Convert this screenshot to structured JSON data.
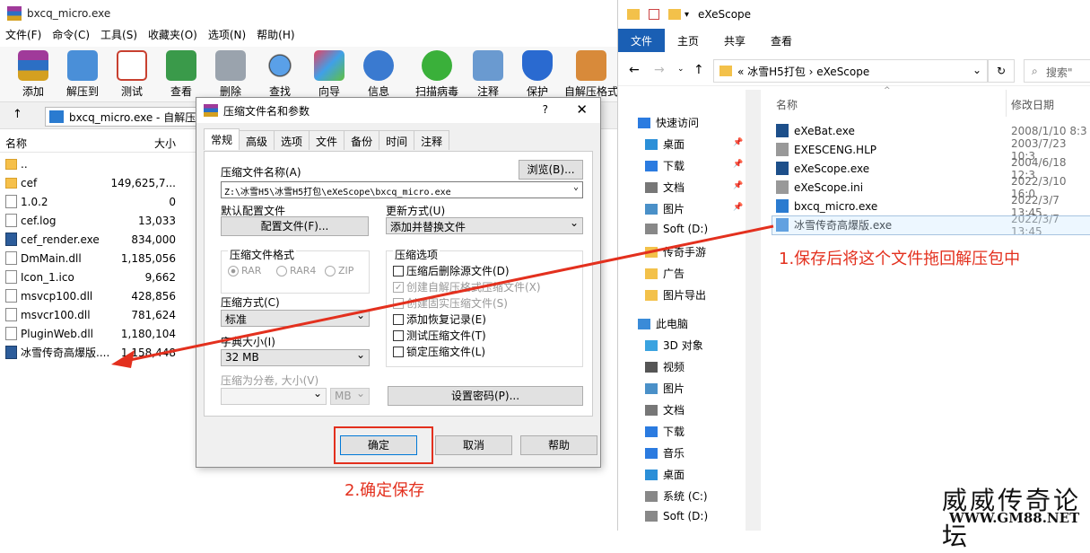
{
  "rar": {
    "title": "bxcq_micro.exe",
    "menu": [
      "文件(F)",
      "命令(C)",
      "工具(S)",
      "收藏夹(O)",
      "选项(N)",
      "帮助(H)"
    ],
    "toolbar": [
      "添加",
      "解压到",
      "测试",
      "查看",
      "删除",
      "查找",
      "向导",
      "信息",
      "扫描病毒",
      "注释",
      "保护",
      "自解压格式"
    ],
    "address": "bxcq_micro.exe - 自解压",
    "columns": {
      "name": "名称",
      "size": "大小"
    },
    "files": [
      {
        "name": "..",
        "size": "",
        "icon": "folder"
      },
      {
        "name": "cef",
        "size": "149,625,7...",
        "icon": "folder"
      },
      {
        "name": "1.0.2",
        "size": "0",
        "icon": "file"
      },
      {
        "name": "cef.log",
        "size": "13,033",
        "icon": "file"
      },
      {
        "name": "cef_render.exe",
        "size": "834,000",
        "icon": "exe"
      },
      {
        "name": "DmMain.dll",
        "size": "1,185,056",
        "icon": "file"
      },
      {
        "name": "Icon_1.ico",
        "size": "9,662",
        "icon": "file"
      },
      {
        "name": "msvcp100.dll",
        "size": "428,856",
        "icon": "file"
      },
      {
        "name": "msvcr100.dll",
        "size": "781,624",
        "icon": "file"
      },
      {
        "name": "PluginWeb.dll",
        "size": "1,180,104",
        "icon": "file"
      },
      {
        "name": "冰雪传奇高爆版....",
        "size": "1,158,448",
        "icon": "exe"
      }
    ]
  },
  "dialog": {
    "title": "压缩文件名和参数",
    "help": "?",
    "tabs": [
      "常规",
      "高级",
      "选项",
      "文件",
      "备份",
      "时间",
      "注释"
    ],
    "archive_name_label": "压缩文件名称(A)",
    "browse": "浏览(B)...",
    "archive_path": "Z:\\冰雪H5\\冰雪H5打包\\eXeScope\\bxcq_micro.exe",
    "default_config_label": "默认配置文件",
    "config_btn": "配置文件(F)...",
    "update_label": "更新方式(U)",
    "update_value": "添加并替换文件",
    "format_label": "压缩文件格式",
    "formats": [
      "RAR",
      "RAR4",
      "ZIP"
    ],
    "options_label": "压缩选项",
    "options": [
      {
        "text": "压缩后删除源文件(D)",
        "checked": false,
        "disabled": false
      },
      {
        "text": "创建自解压格式压缩文件(X)",
        "checked": true,
        "disabled": true
      },
      {
        "text": "创建固实压缩文件(S)",
        "checked": false,
        "disabled": true
      },
      {
        "text": "添加恢复记录(E)",
        "checked": false,
        "disabled": false
      },
      {
        "text": "测试压缩文件(T)",
        "checked": false,
        "disabled": false
      },
      {
        "text": "锁定压缩文件(L)",
        "checked": false,
        "disabled": false
      }
    ],
    "method_label": "压缩方式(C)",
    "method_value": "标准",
    "dict_label": "字典大小(I)",
    "dict_value": "32 MB",
    "split_label": "压缩为分卷, 大小(V)",
    "split_unit": "MB",
    "password_btn": "设置密码(P)...",
    "ok": "确定",
    "cancel": "取消",
    "helpbtn": "帮助"
  },
  "explorer": {
    "title": "eXeScope",
    "ribbon": [
      "文件",
      "主页",
      "共享",
      "查看"
    ],
    "crumbs": "«  冰雪H5打包  ›  eXeScope",
    "search": "搜索\"",
    "col_name": "名称",
    "col_date": "修改日期",
    "nav": [
      {
        "label": "快速访问",
        "color": "#2b7be0",
        "pin": false
      },
      {
        "label": "桌面",
        "color": "#2b8fd8",
        "pin": true
      },
      {
        "label": "下载",
        "color": "#2b7be0",
        "pin": true
      },
      {
        "label": "文档",
        "color": "#777",
        "pin": true
      },
      {
        "label": "图片",
        "color": "#4a90c8",
        "pin": true
      },
      {
        "label": "Soft (D:)",
        "color": "#888",
        "pin": false
      },
      {
        "label": "传奇手游",
        "color": "#f3c14a",
        "pin": false
      },
      {
        "label": "广告",
        "color": "#f3c14a",
        "pin": false
      },
      {
        "label": "图片导出",
        "color": "#f3c14a",
        "pin": false
      },
      {
        "label": "此电脑",
        "color": "#3a8bd8",
        "pin": false
      },
      {
        "label": "3D 对象",
        "color": "#3aa3e0",
        "pin": false
      },
      {
        "label": "视频",
        "color": "#555",
        "pin": false
      },
      {
        "label": "图片",
        "color": "#4a90c8",
        "pin": false
      },
      {
        "label": "文档",
        "color": "#777",
        "pin": false
      },
      {
        "label": "下载",
        "color": "#2b7be0",
        "pin": false
      },
      {
        "label": "音乐",
        "color": "#2b7be0",
        "pin": false
      },
      {
        "label": "桌面",
        "color": "#2b8fd8",
        "pin": false
      },
      {
        "label": "系统 (C:)",
        "color": "#888",
        "pin": false
      },
      {
        "label": "Soft (D:)",
        "color": "#888",
        "pin": false
      }
    ],
    "files": [
      {
        "name": "eXeBat.exe",
        "date": "2008/1/10 8:3",
        "icon": "#1d4f8a"
      },
      {
        "name": "EXESCENG.HLP",
        "date": "2003/7/23 10:3",
        "icon": "#999"
      },
      {
        "name": "eXeScope.exe",
        "date": "2004/6/18 12:3",
        "icon": "#1d4f8a"
      },
      {
        "name": "eXeScope.ini",
        "date": "2022/3/10 16:0",
        "icon": "#999"
      },
      {
        "name": "bxcq_micro.exe",
        "date": "2022/3/7 13:45",
        "icon": "#2a7bd0"
      },
      {
        "name": "冰雪传奇高爆版.exe",
        "date": "2022/3/7 13:45",
        "icon": "#2a7bd0"
      }
    ]
  },
  "annotations": {
    "step1": "1.保存后将这个文件拖回解压包中",
    "step2": "2.确定保存",
    "color": "#e3301e"
  },
  "watermark": {
    "title": "威威传奇论坛",
    "url": "WWW.GM88.NET"
  }
}
